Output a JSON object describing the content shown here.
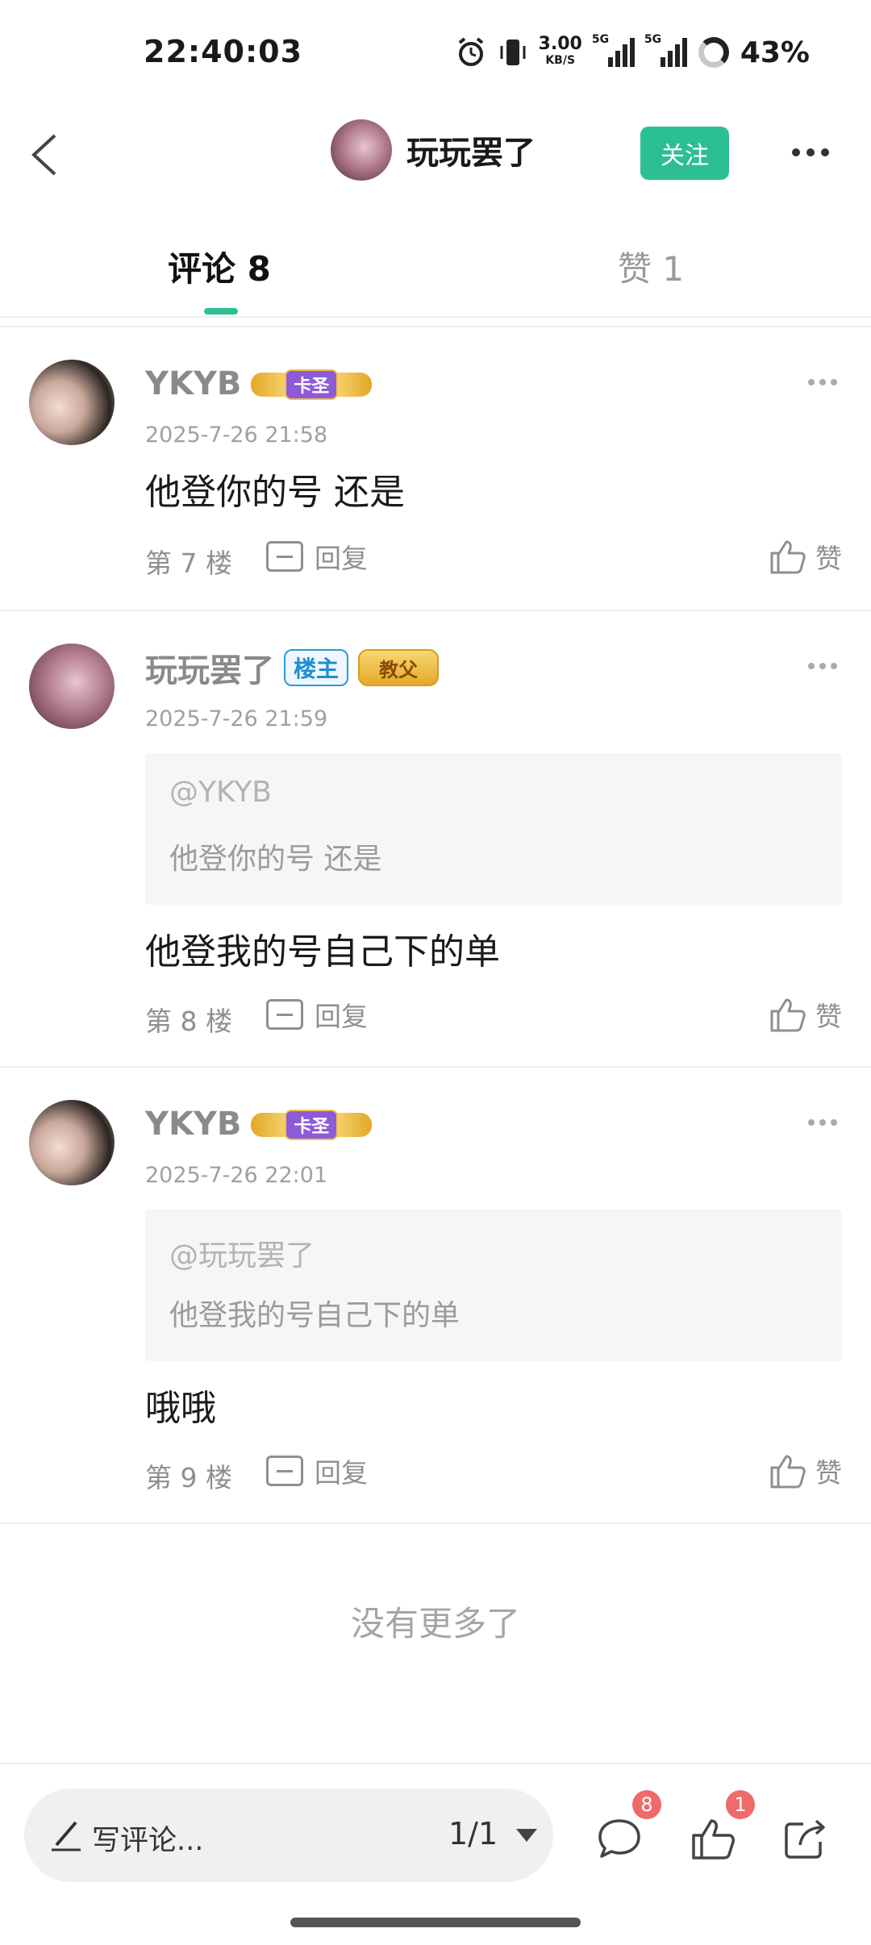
{
  "status_bar": {
    "time": "22:40:03",
    "net_speed": "3.00",
    "net_unit": "KB/S",
    "sig1_label": "5G",
    "sig2_label": "5G",
    "battery": "43%"
  },
  "header": {
    "username": "玩玩罢了",
    "follow_label": "关注"
  },
  "tabs": [
    {
      "label": "评论 8"
    },
    {
      "label": "赞 1"
    }
  ],
  "comments": [
    {
      "user": "YKYB",
      "badge": "卡圣",
      "time": "2025-7-26 21:58",
      "text": "他登你的号  还是",
      "floor": "第 7 楼",
      "reply_label": "回复",
      "like_label": "赞"
    },
    {
      "user": "玩玩罢了",
      "host_badge": "楼主",
      "badge": "教父",
      "time": "2025-7-26 21:59",
      "quote_user": "@YKYB",
      "quote_text": "他登你的号  还是",
      "text": "他登我的号自己下的单",
      "floor": "第 8 楼",
      "reply_label": "回复",
      "like_label": "赞"
    },
    {
      "user": "YKYB",
      "badge": "卡圣",
      "time": "2025-7-26 22:01",
      "quote_user": "@玩玩罢了",
      "quote_text": "他登我的号自己下的单",
      "text": "哦哦",
      "floor": "第 9 楼",
      "reply_label": "回复",
      "like_label": "赞"
    }
  ],
  "end_text": "没有更多了",
  "bottom_bar": {
    "write_placeholder": "写评论...",
    "page_indicator": "1/1",
    "comment_count": "8",
    "like_count": "1"
  },
  "colors": {
    "accent": "#2dbf94",
    "badge_red": "#f06a6a",
    "host_badge_blue": "#1d8fd0"
  }
}
